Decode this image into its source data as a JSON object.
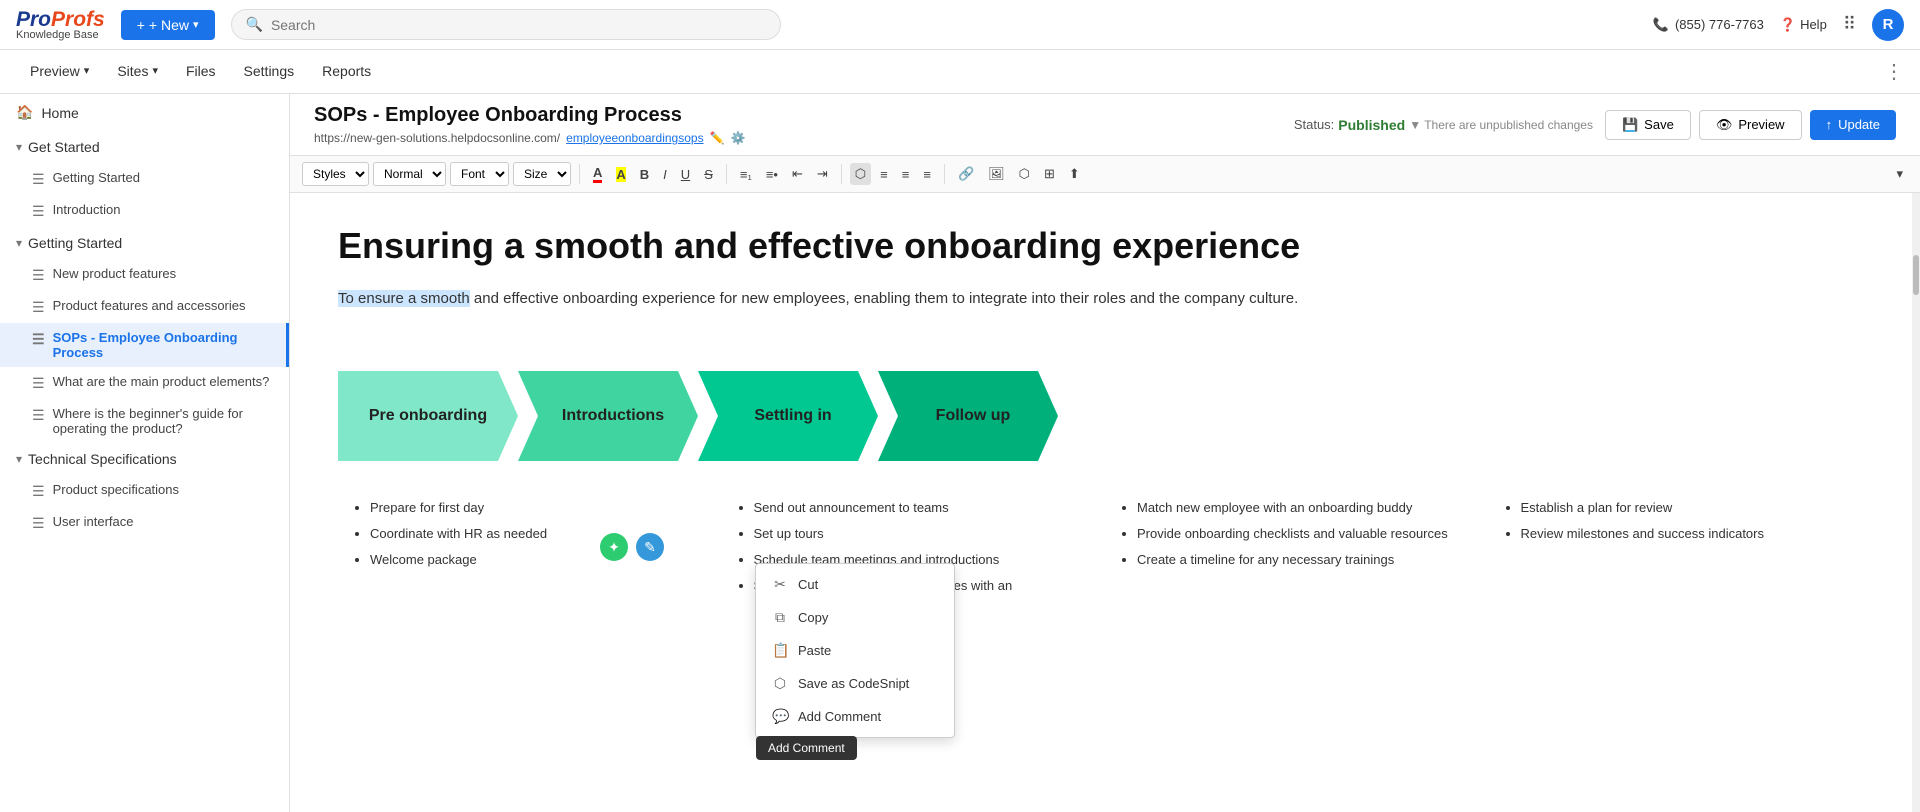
{
  "logo": {
    "brand": "ProProfs",
    "sub": "Knowledge Base"
  },
  "topbar": {
    "new_btn": "+ New",
    "search_placeholder": "Search",
    "phone": "(855) 776-7763",
    "help": "Help",
    "avatar_initial": "R"
  },
  "nav": {
    "items": [
      "Preview",
      "Sites",
      "Files",
      "Settings",
      "Reports"
    ]
  },
  "page": {
    "title": "SOPs - Employee Onboarding Process",
    "url_base": "https://new-gen-solutions.helpdocsonline.com/",
    "url_slug": "employeeonboardingsops",
    "status_label": "Status:",
    "status_value": "Published",
    "unpublished": "▼ There are unpublished changes",
    "save_btn": "Save",
    "preview_btn": "Preview",
    "update_btn": "Update"
  },
  "toolbar": {
    "styles": "Styles",
    "normal": "Normal",
    "font": "Font",
    "size": "Size"
  },
  "sidebar": {
    "home": "Home",
    "sections": [
      {
        "label": "Get Started",
        "items": [
          {
            "label": "Getting Started",
            "icon": "doc"
          },
          {
            "label": "Introduction",
            "icon": "doc"
          }
        ]
      },
      {
        "label": "Getting Started",
        "items": [
          {
            "label": "New product features",
            "icon": "doc"
          },
          {
            "label": "Product features and accessories",
            "icon": "doc"
          },
          {
            "label": "SOPs - Employee Onboarding Process",
            "icon": "doc",
            "active": true
          },
          {
            "label": "What are the main product elements?",
            "icon": "doc"
          },
          {
            "label": "Where is the beginner's guide for operating the product?",
            "icon": "doc"
          }
        ]
      },
      {
        "label": "Technical Specifications",
        "items": [
          {
            "label": "Product specifications",
            "icon": "doc"
          },
          {
            "label": "User interface",
            "icon": "doc"
          }
        ]
      }
    ]
  },
  "editor": {
    "heading": "Ensuring a smooth and effective onboarding experience",
    "description": "To ensure a smooth and effective onboarding experience for new employees, enabling them to integrate into their roles and the company culture.",
    "selected_text": "To ensure a smooth",
    "steps": [
      {
        "label": "Pre onboarding",
        "color": "light"
      },
      {
        "label": "Introductions",
        "color": "medium-light"
      },
      {
        "label": "Settling in",
        "color": "medium"
      },
      {
        "label": "Follow up",
        "color": "dark"
      }
    ],
    "bullets": [
      [
        "Prepare for first day",
        "Coordinate with HR as needed",
        "Welcome package"
      ],
      [
        "Send out announcement to teams",
        "Set up tours",
        "Schedule team meetings and introductions",
        "Share policies, values and guidelines with an"
      ],
      [
        "Match new employee with an onboarding buddy",
        "Provide onboarding checklists and valuable resources",
        "Create a timeline for any necessary trainings"
      ],
      [
        "Establish a plan for review",
        "Review milestones and success indicators"
      ]
    ]
  },
  "context_menu": {
    "items": [
      {
        "label": "Cut",
        "icon": "✂"
      },
      {
        "label": "Copy",
        "icon": "⧉"
      },
      {
        "label": "Paste",
        "icon": "📋"
      },
      {
        "label": "Save as CodeSnipt",
        "icon": "⬡"
      },
      {
        "label": "Add Comment",
        "icon": "💬"
      }
    ],
    "tooltip": "Add Comment"
  }
}
